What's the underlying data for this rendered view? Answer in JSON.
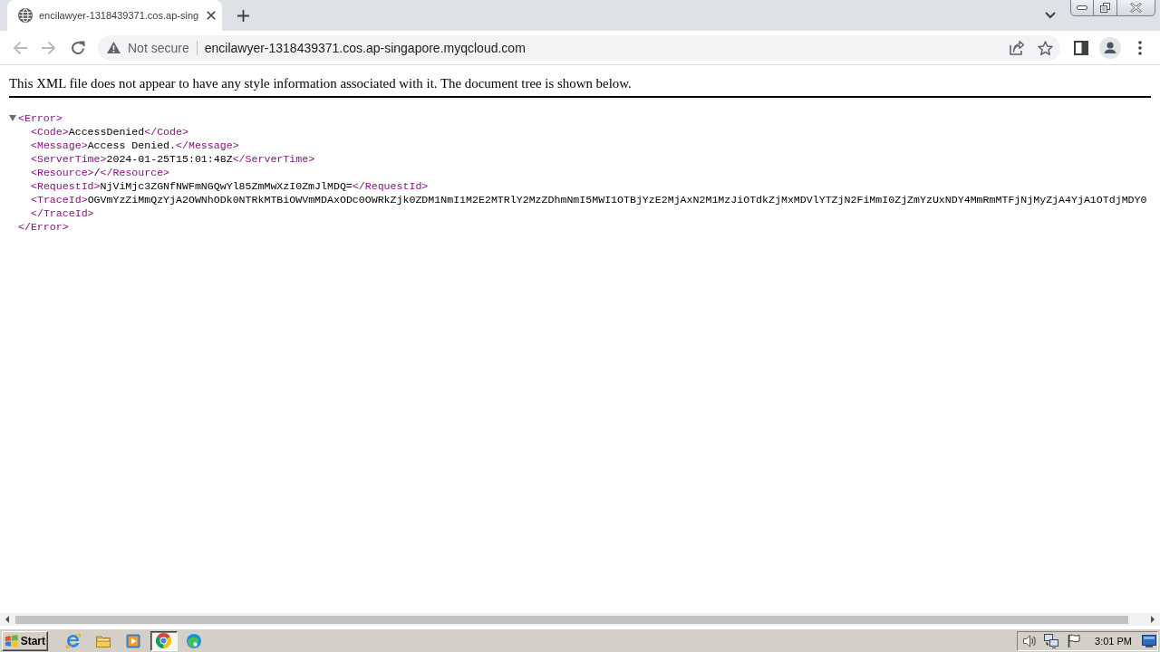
{
  "browser": {
    "tabs": [
      {
        "title": "encilawyer-1318439371.cos.ap-sing",
        "selected": true
      }
    ],
    "nav_buttons": [
      {
        "kind": "back",
        "disabled": true
      },
      {
        "kind": "forward",
        "disabled": true
      },
      {
        "kind": "reload",
        "disabled": false
      }
    ],
    "address_bar": {
      "security_label": "Not secure",
      "url": "encilawyer-1318439371.cos.ap-singapore.myqcloud.com"
    }
  },
  "page": {
    "notice": "This XML file does not appear to have any style information associated with it. The document tree is shown below.",
    "xml_tree": {
      "open_tag": "<Error>",
      "close_tag": "</Error>",
      "expanded": true,
      "children": [
        {
          "kind": "inline",
          "open_tag": "<Code>",
          "text": "AccessDenied",
          "close_tag": "</Code>"
        },
        {
          "kind": "inline",
          "open_tag": "<Message>",
          "text": "Access Denied.",
          "close_tag": "</Message>"
        },
        {
          "kind": "inline",
          "open_tag": "<ServerTime>",
          "text": "2024-01-25T15:01:48Z",
          "close_tag": "</ServerTime>"
        },
        {
          "kind": "inline",
          "open_tag": "<Resource>",
          "text": "/",
          "close_tag": "</Resource>"
        },
        {
          "kind": "inline",
          "open_tag": "<RequestId>",
          "text": "NjViMjc3ZGNfNWFmNGQwYl85ZmMwXzI0ZmJlMDQ=",
          "close_tag": "</RequestId>"
        },
        {
          "kind": "split",
          "open_tag": "<TraceId>",
          "text": "OGVmYzZiMmQzYjA2OWNhODk0NTRkMTBiOWVmMDAxODc0OWRkZjk0ZDM1NmI1M2E2MTRlY2MzZDhmNmI5MWI1OTBjYzE2MjAxN2M1MzJiOTdkZjMxMDVlYTZjN2FiMmI0ZjZmYzUxNDY4MmRmMTFjNjMyZjA4YjA1OTdjMDY0",
          "close_tag": "</TraceId>"
        }
      ]
    }
  },
  "taskbar": {
    "start_label": "Start",
    "quick_launch": [
      {
        "kind": "ie",
        "selected": false
      },
      {
        "kind": "folder",
        "selected": false
      },
      {
        "kind": "media",
        "selected": false
      },
      {
        "kind": "chrome",
        "selected": true
      },
      {
        "kind": "edge",
        "selected": false
      }
    ],
    "clock": "3:01 PM"
  }
}
